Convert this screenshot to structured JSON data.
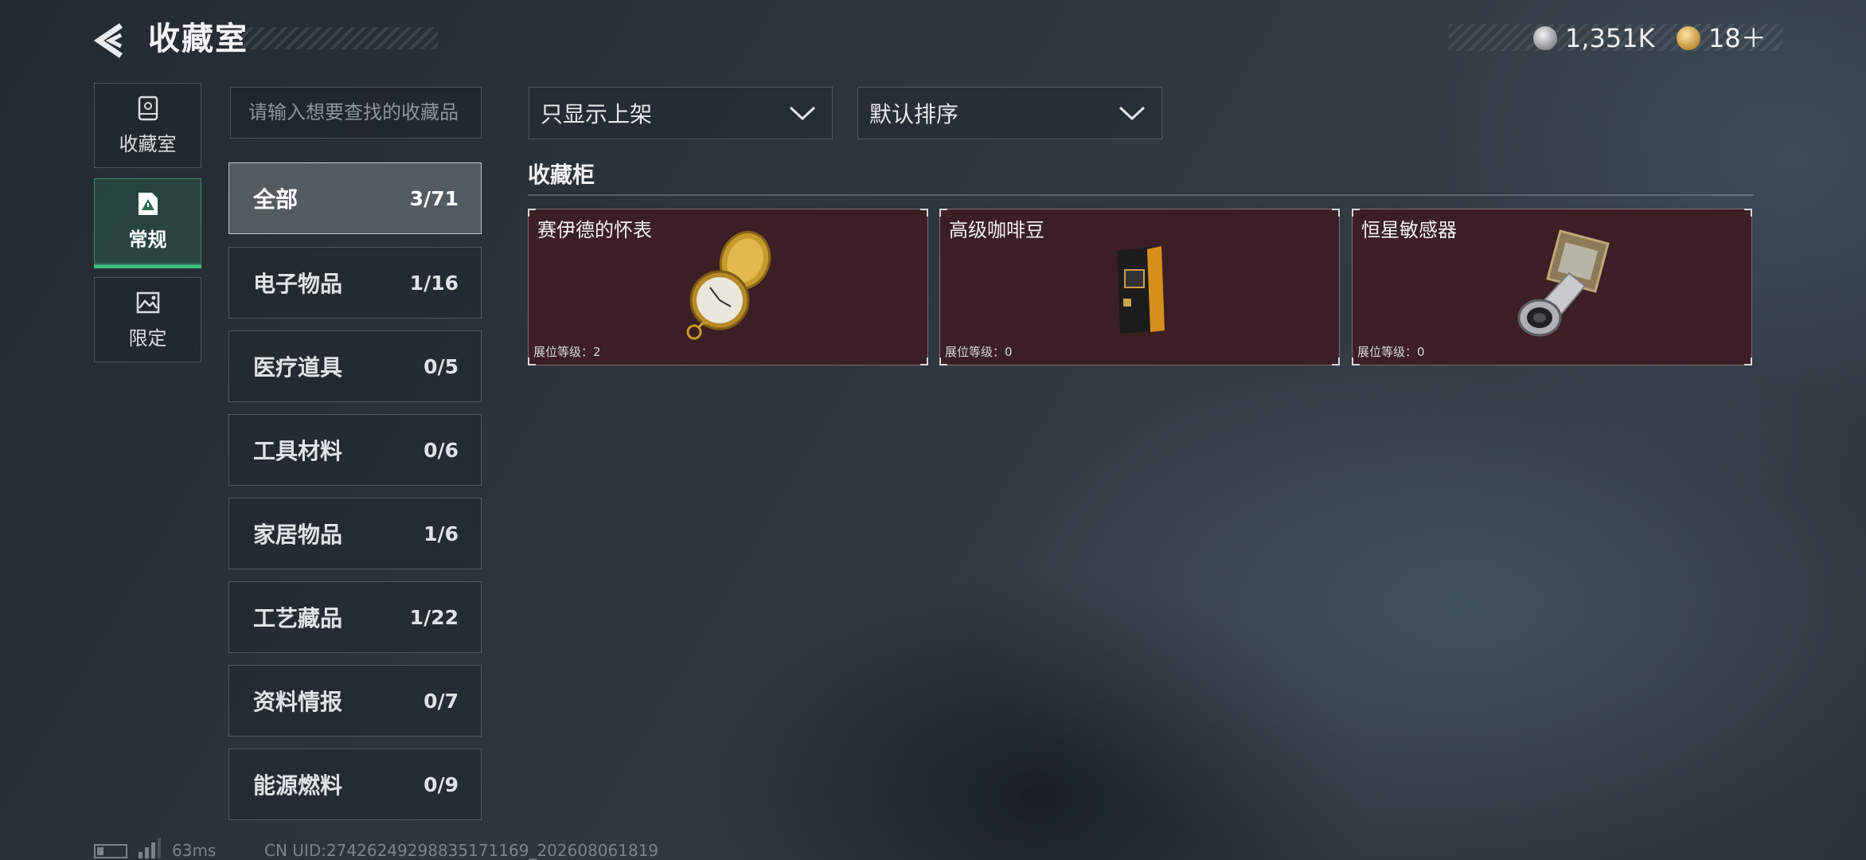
{
  "header": {
    "title": "收藏室",
    "currency": [
      {
        "icon": "silver-coin-icon",
        "value": "1,351K"
      },
      {
        "icon": "gold-coin-icon",
        "value": "18＋"
      }
    ]
  },
  "sidebar": {
    "items": [
      {
        "label": "收藏室",
        "icon": "display-case-icon",
        "active": false
      },
      {
        "label": "常规",
        "icon": "document-warning-icon",
        "active": true
      },
      {
        "label": "限定",
        "icon": "image-icon",
        "active": false
      }
    ]
  },
  "search": {
    "placeholder": "请输入想要查找的收藏品"
  },
  "categories": [
    {
      "label": "全部",
      "count": "3/71",
      "active": true
    },
    {
      "label": "电子物品",
      "count": "1/16"
    },
    {
      "label": "医疗道具",
      "count": "0/5"
    },
    {
      "label": "工具材料",
      "count": "0/6"
    },
    {
      "label": "家居物品",
      "count": "1/6"
    },
    {
      "label": "工艺藏品",
      "count": "1/22"
    },
    {
      "label": "资料情报",
      "count": "0/7"
    },
    {
      "label": "能源燃料",
      "count": "0/9"
    }
  ],
  "filters": {
    "display_filter": "只显示上架",
    "sort": "默认排序"
  },
  "section_title": "收藏柜",
  "items": [
    {
      "name": "赛伊德的怀表",
      "level": "展位等级：2",
      "icon": "pocket-watch-icon"
    },
    {
      "name": "高级咖啡豆",
      "level": "展位等级：0",
      "icon": "coffee-bag-icon"
    },
    {
      "name": "恒星敏感器",
      "level": "展位等级：0",
      "icon": "star-sensor-icon"
    }
  ],
  "colors": {
    "card_bg": "#3b1f24",
    "active_nav": "#3fbf7f"
  },
  "footer": {
    "ping": "63ms",
    "uid": "CN UID:27426249298835171169_202608061819"
  }
}
